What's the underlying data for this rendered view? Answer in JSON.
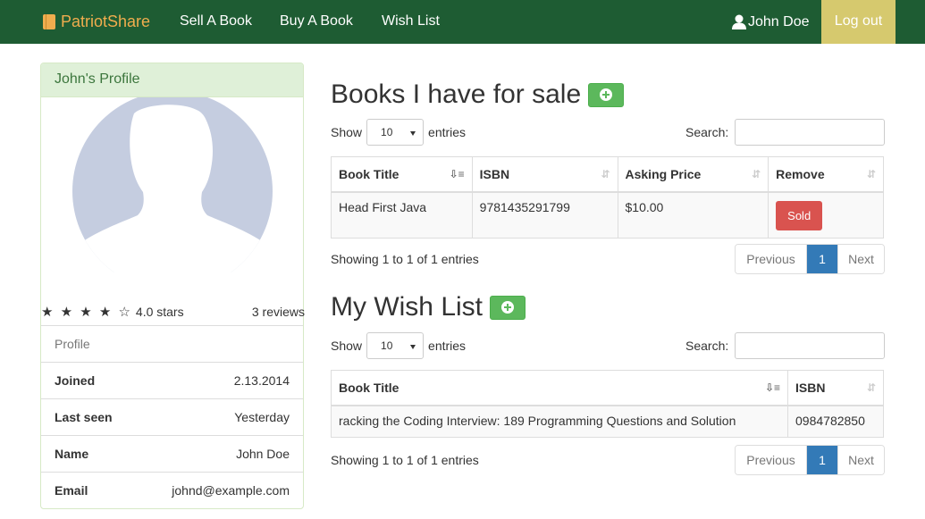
{
  "nav": {
    "brand": "PatriotShare",
    "links": [
      "Sell A Book",
      "Buy A Book",
      "Wish List"
    ],
    "user": "John Doe",
    "logout": "Log out"
  },
  "profile": {
    "title": "John's Profile",
    "rating_stars": "★ ★ ★ ★ ☆",
    "rating_label": "4.0 stars",
    "reviews": "3 reviews",
    "section": "Profile",
    "rows": [
      {
        "k": "Joined",
        "v": "2.13.2014"
      },
      {
        "k": "Last seen",
        "v": "Yesterday"
      },
      {
        "k": "Name",
        "v": "John Doe"
      },
      {
        "k": "Email",
        "v": "johnd@example.com"
      }
    ]
  },
  "sale": {
    "heading": "Books I have for sale",
    "show": "Show",
    "entries_count": "10",
    "entries": "entries",
    "search": "Search:",
    "columns": [
      "Book Title",
      "ISBN",
      "Asking Price",
      "Remove"
    ],
    "row": {
      "title": "Head First Java",
      "isbn": "9781435291799",
      "price": "$10.00",
      "action": "Sold"
    },
    "info": "Showing 1 to 1 of 1 entries",
    "pager": {
      "prev": "Previous",
      "page": "1",
      "next": "Next"
    }
  },
  "wish": {
    "heading": "My Wish List",
    "show": "Show",
    "entries_count": "10",
    "entries": "entries",
    "search": "Search:",
    "columns": [
      "Book Title",
      "ISBN"
    ],
    "row": {
      "title": "racking the Coding Interview: 189 Programming Questions and Solution",
      "isbn": "0984782850"
    },
    "info": "Showing 1 to 1 of 1 entries",
    "pager": {
      "prev": "Previous",
      "page": "1",
      "next": "Next"
    }
  }
}
